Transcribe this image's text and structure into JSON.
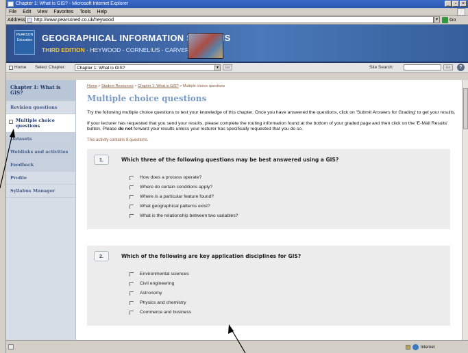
{
  "window": {
    "title": "Chapter 1: What is GIS? - Microsoft Internet Explorer",
    "controls": [
      "_",
      "▫",
      "×"
    ]
  },
  "menu": [
    "File",
    "Edit",
    "View",
    "Favorites",
    "Tools",
    "Help"
  ],
  "address": {
    "label": "Address",
    "url": "http://www.pearsoned.co.uk/heywood",
    "go_label": "Go"
  },
  "banner": {
    "logo_text": "PEARSON Education",
    "title": "GEOGRAPHICAL INFORMATION SYSTEMS",
    "edition": "THIRD EDITION",
    "authors": " - HEYWOOD - CORNELIUS - CARVER"
  },
  "site_toolbar": {
    "home": "Home",
    "select_chapter": "Select Chapter:",
    "chapter_value": "Chapter 1: What is GIS?",
    "go": "Go",
    "site_search": "Site Search:",
    "search_go": "Go",
    "help": "?"
  },
  "sidebar": {
    "items": [
      {
        "label": "Chapter 1: What is GIS?"
      },
      {
        "label": "Revision questions"
      },
      {
        "label": "Multiple choice questions"
      },
      {
        "label": "Datasets"
      },
      {
        "label": "Weblinks and activities"
      },
      {
        "label": "Feedback"
      },
      {
        "label": "Profile"
      },
      {
        "label": "Syllabus Manager"
      }
    ]
  },
  "main": {
    "breadcrumb": [
      "Home",
      "Student Resources",
      "Chapter 1: What is GIS?",
      "Multiple choice questions"
    ],
    "title": "Multiple choice questions",
    "intro1": "Try the following multiple choice questions to test your knowledge of this chapter. Once you have answered the questions, click on 'Submit Answers for Grading' to get your results.",
    "intro2_a": "If your lecturer has requested that you send your results, please complete the routing information found at the bottom of your graded page and then click on the 'E-Mail Results' button. Please ",
    "intro2_bold": "do not",
    "intro2_b": " forward your results unless your lecturer has specifically requested that you do so.",
    "contains_note": "This activity contains 8 questions."
  },
  "questions": [
    {
      "number": "1.",
      "text": "Which three of the following questions may be best answered using a GIS?",
      "options": [
        "How does a process operate?",
        "Where do certain conditions apply?",
        "Where is a particular feature found?",
        "What geographical patterns exist?",
        "What is the relationship between two variables?"
      ]
    },
    {
      "number": "2.",
      "text": "Which of the following are key application disciplines for GIS?",
      "options": [
        "Environmental sciences",
        "Civil engineering",
        "Astronomy",
        "Physics and chemistry",
        "Commerce and business"
      ]
    }
  ],
  "status": {
    "zone": "Internet"
  }
}
